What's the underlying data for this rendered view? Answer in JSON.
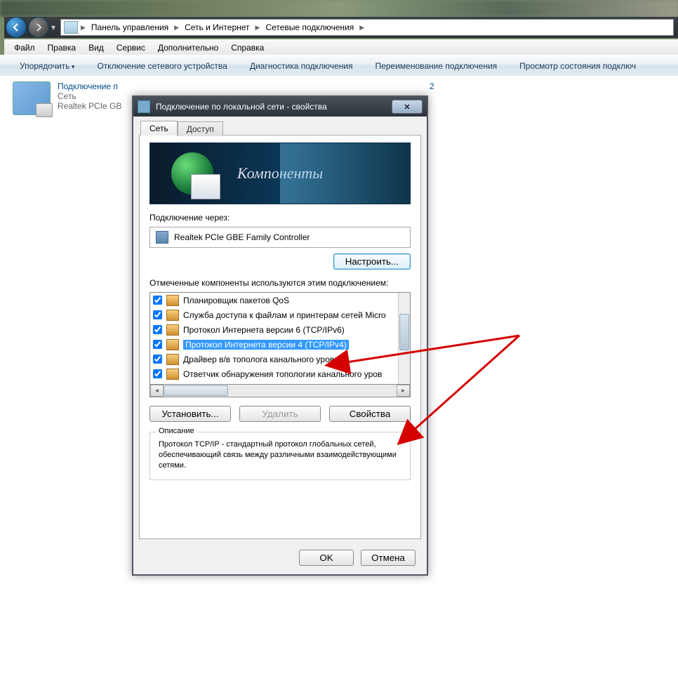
{
  "breadcrumb": {
    "items": [
      "Панель управления",
      "Сеть и Интернет",
      "Сетевые подключения"
    ]
  },
  "menubar": {
    "items": [
      "Файл",
      "Правка",
      "Вид",
      "Сервис",
      "Дополнительно",
      "Справка"
    ]
  },
  "toolbar": {
    "organize": "Упорядочить",
    "disable": "Отключение сетевого устройства",
    "diagnose": "Диагностика подключения",
    "rename": "Переименование подключения",
    "status": "Просмотр состояния подключ"
  },
  "connection_item": {
    "name": "Подключение п",
    "network": "Сеть",
    "adapter": "Realtek PCIe GB"
  },
  "background_hint": "2",
  "dialog": {
    "title": "Подключение по локальной сети - свойства",
    "tabs": {
      "network": "Сеть",
      "access": "Доступ"
    },
    "banner_text": "Компоненты",
    "connect_via_label": "Подключение через:",
    "adapter_name": "Realtek PCIe GBE Family Controller",
    "configure_btn": "Настроить...",
    "components_label": "Отмеченные компоненты используются этим подключением:",
    "components": [
      {
        "label": "Планировщик пакетов QoS",
        "checked": true,
        "selected": false
      },
      {
        "label": "Служба доступа к файлам и принтерам сетей Micro",
        "checked": true,
        "selected": false
      },
      {
        "label": "Протокол Интернета версии 6 (TCP/IPv6)",
        "checked": true,
        "selected": false
      },
      {
        "label": "Протокол Интернета версии 4 (TCP/IPv4)",
        "checked": true,
        "selected": true
      },
      {
        "label": "Драйвер в/в тополога канального уровня",
        "checked": true,
        "selected": false
      },
      {
        "label": "Ответчик обнаружения топологии канального уров",
        "checked": true,
        "selected": false
      }
    ],
    "install_btn": "Установить...",
    "remove_btn": "Удалить",
    "properties_btn": "Свойства",
    "desc_legend": "Описание",
    "desc_text": "Протокол TCP/IP - стандартный протокол глобальных сетей, обеспечивающий связь между различными взаимодействующими сетями.",
    "ok_btn": "OK",
    "cancel_btn": "Отмена"
  }
}
